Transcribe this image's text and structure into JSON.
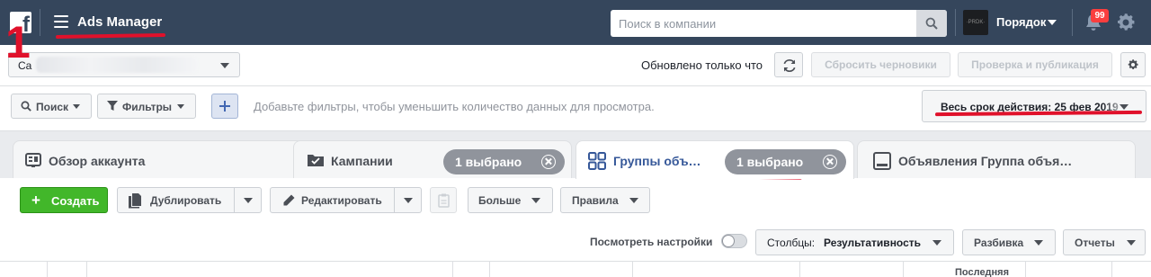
{
  "topbar": {
    "logo_glyph": "f",
    "app_title": "Ads Manager",
    "search_placeholder": "Поиск в компании",
    "business_name": "Порядок",
    "business_avatar_text": "·PRDK·",
    "notifications_count": "99"
  },
  "toolbar": {
    "account_prefix": "Ca",
    "updated_text": "Обновлено только что",
    "discard_drafts_label": "Сбросить черновики",
    "review_publish_label": "Проверка и публикация"
  },
  "filters": {
    "search_label": "Поиск",
    "filters_label": "Фильтры",
    "hint": "Добавьте фильтры, чтобы уменьшить количество данных для просмотра.",
    "date_range_label": "Весь срок действия: 25 фев 2019"
  },
  "tabs": {
    "account_overview": "Обзор аккаунта",
    "campaigns": "Кампании",
    "campaigns_chip": "1 выбрано",
    "adsets": "Группы объ…",
    "adsets_chip": "1 выбрано",
    "ads": "Объявления Группа объя…"
  },
  "actions": {
    "create_label": "Создать",
    "duplicate_label": "Дублировать",
    "edit_label": "Редактировать",
    "more_label": "Больше",
    "rules_label": "Правила",
    "view_settings_label": "Посмотреть настройки",
    "columns_prefix": "Столбцы:",
    "columns_value": "Результативность",
    "breakdown_label": "Разбивка",
    "reports_label": "Отчеты"
  },
  "grid": {
    "cut_header_text": "Последняя"
  },
  "annotation": {
    "step_number": "1"
  },
  "colors": {
    "topbar": "#35465c",
    "create_button": "#42b72a",
    "active_tab_text": "#365899",
    "chip": "#90949c",
    "annotation_red": "#e0112b",
    "badge": "#fa3e3e"
  },
  "icons": [
    "facebook-logo",
    "hamburger-menu-icon",
    "search-icon",
    "chevron-down-icon",
    "bell-icon",
    "gear-icon",
    "refresh-icon",
    "funnel-icon",
    "plus-icon",
    "dashboard-icon",
    "folder-icon",
    "grid-icon",
    "ad-icon",
    "close-circle-icon",
    "copy-icon",
    "pencil-icon",
    "clipboard-icon"
  ]
}
